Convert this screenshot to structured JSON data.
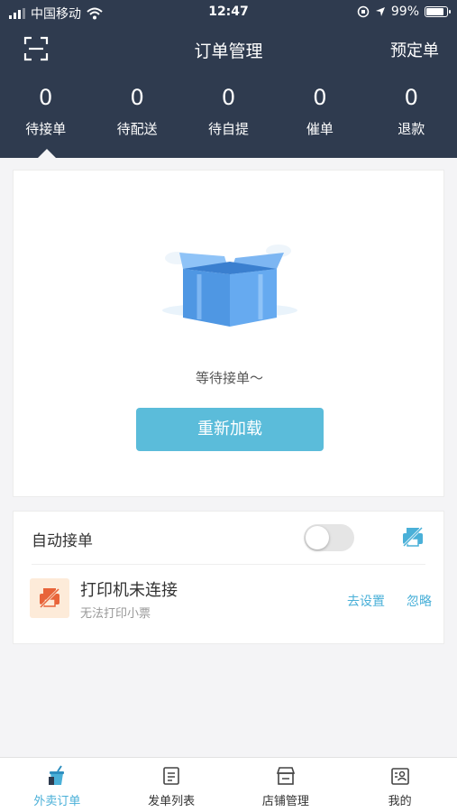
{
  "status_bar": {
    "carrier": "中国移动",
    "time": "12:47",
    "battery": "99%"
  },
  "header": {
    "title": "订单管理",
    "right_action": "预定单"
  },
  "stats": [
    {
      "count": "0",
      "label": "待接单"
    },
    {
      "count": "0",
      "label": "待配送"
    },
    {
      "count": "0",
      "label": "待自提"
    },
    {
      "count": "0",
      "label": "催单"
    },
    {
      "count": "0",
      "label": "退款"
    }
  ],
  "empty_state": {
    "message": "等待接单～",
    "reload_label": "重新加载"
  },
  "settings": {
    "auto_accept_label": "自动接单",
    "printer_title": "打印机未连接",
    "printer_subtitle": "无法打印小票",
    "setup_link": "去设置",
    "ignore_link": "忽略"
  },
  "tabs": [
    {
      "label": "外卖订单",
      "icon": "takeout-cup-icon",
      "active": true
    },
    {
      "label": "发单列表",
      "icon": "document-list-icon",
      "active": false
    },
    {
      "label": "店铺管理",
      "icon": "storefront-icon",
      "active": false
    },
    {
      "label": "我的",
      "icon": "profile-card-icon",
      "active": false
    }
  ],
  "colors": {
    "header_bg": "#2f3b4f",
    "accent": "#4ab0d8",
    "button": "#5bbcda",
    "printer_warning": "#e8643a"
  }
}
